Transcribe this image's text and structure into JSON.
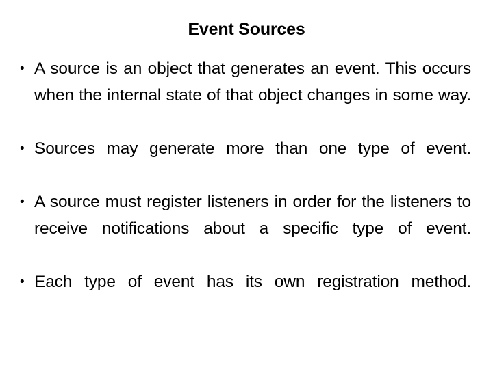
{
  "slide": {
    "title": "Event Sources",
    "bullet_marker": "•",
    "bullets": [
      {
        "text": "A source is an object that generates an event. This occurs when the internal state of that object changes in some way."
      },
      {
        "text": "Sources may generate more than one type of event."
      },
      {
        "text": "A source must register listeners in order for the listeners to receive notifications about a specific type of event."
      },
      {
        "text": "Each type of event has its own registration method."
      }
    ],
    "colors": {
      "background": "#ffffff",
      "text": "#000000",
      "title": "#000000"
    }
  }
}
